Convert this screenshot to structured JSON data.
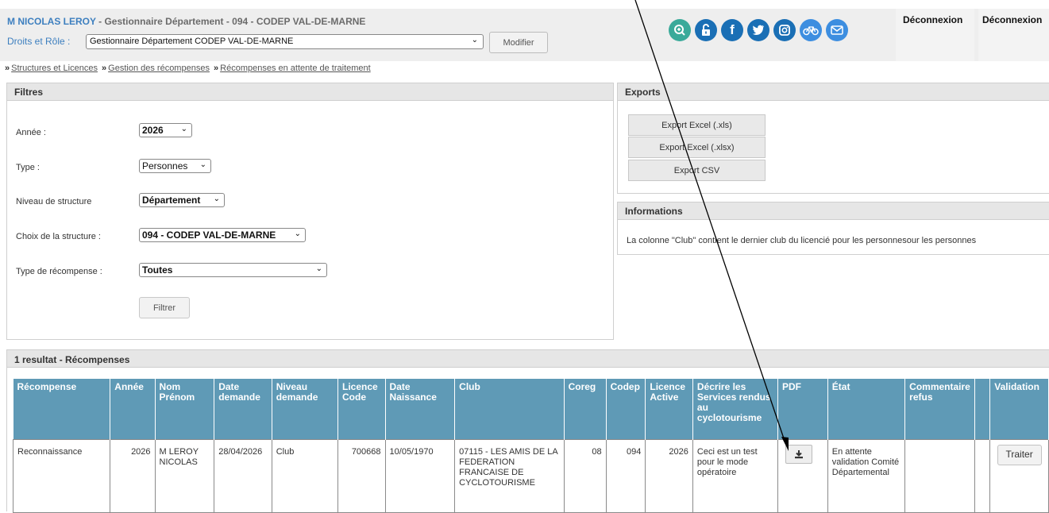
{
  "header": {
    "user_name": "M NICOLAS LEROY",
    "user_role": " - Gestionnaire Département - 094 - CODEP VAL-DE-MARNE",
    "rights_label": "Droits et Rôle :",
    "rights_value": "Gestionnaire Département CODEP VAL-DE-MARNE",
    "modify_label": "Modifier",
    "logout_label_1": "Déconnexion",
    "logout_label_2": "Déconnexion",
    "icons": [
      {
        "name": "search-plus-icon",
        "color": "#3aaa9a"
      },
      {
        "name": "unlock-icon",
        "color": "#1a6fb5"
      },
      {
        "name": "facebook-icon",
        "color": "#1a6fb5"
      },
      {
        "name": "twitter-icon",
        "color": "#1a6fb5"
      },
      {
        "name": "instagram-icon",
        "color": "#1a6fb5"
      },
      {
        "name": "bike-icon",
        "color": "#3d8ee0"
      },
      {
        "name": "mail-icon",
        "color": "#3d8ee0"
      }
    ]
  },
  "breadcrumb": {
    "item1": "Structures et  Licences",
    "item2": "Gestion des récompenses",
    "item3": "Récompenses en attente de traitement",
    "separator": "»"
  },
  "filters": {
    "title": "Filtres",
    "year_label": "Année :",
    "year_value": "2026",
    "type_label": "Type :",
    "type_value": "Personnes",
    "level_label": "Niveau de structure",
    "level_value": "Département",
    "structure_label": "Choix de la structure :",
    "structure_value": "094 - CODEP VAL-DE-MARNE",
    "reward_type_label": "Type de récompense :",
    "reward_type_value": "Toutes",
    "filter_button": "Filtrer"
  },
  "exports": {
    "title": "Exports",
    "xls": "Export Excel (.xls)",
    "xlsx": "Export Excel (.xlsx)",
    "csv": "Export CSV"
  },
  "informations": {
    "title": "Informations",
    "text": "La colonne \"Club\" contient le dernier club du licencié pour les personnes",
    "text_overflow": "our les personnes"
  },
  "results": {
    "title": "1 resultat - Récompenses",
    "columns": [
      "Récompense",
      "Année",
      "Nom Prénom",
      "Date demande",
      "Niveau demande",
      "Licence Code",
      "Date Naissance",
      "Club",
      "Coreg",
      "Codep",
      "Licence Active",
      "Décrire les Services rendus au cyclotourisme",
      "PDF",
      "État",
      "Commentaire refus",
      "",
      "Validation"
    ],
    "row": {
      "recompense": "Reconnaissance",
      "annee": "2026",
      "nom": "M LEROY NICOLAS",
      "date_demande": "28/04/2026",
      "niveau": "Club",
      "licence_code": "700668",
      "naissance": "10/05/1970",
      "club": "07115 - LES AMIS DE LA FEDERATION FRANCAISE DE CYCLOTOURISME",
      "coreg": "08",
      "codep": "094",
      "licence_active": "2026",
      "services": "Ceci est un test pour le mode opératoire",
      "etat": "En attente validation Comité Départemental",
      "commentaire": "",
      "validation_button": "Traiter"
    }
  }
}
